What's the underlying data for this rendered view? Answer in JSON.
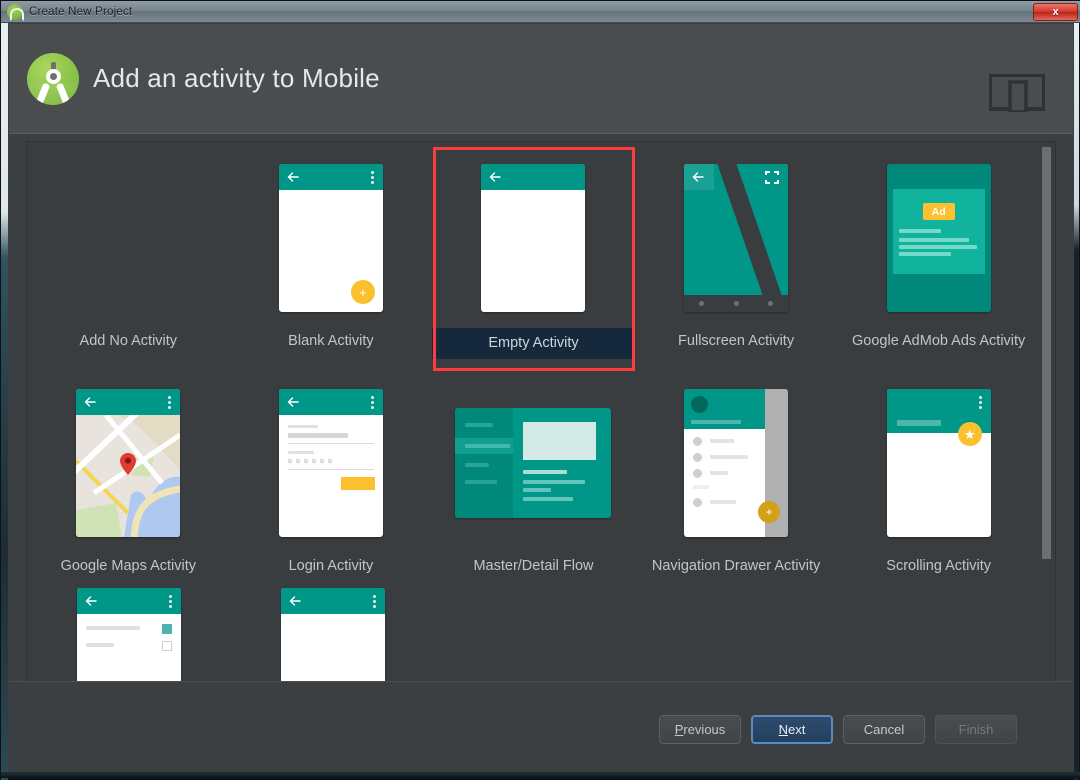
{
  "window": {
    "title": "Create New Project",
    "title_icon": "android-studio-icon",
    "close_label": "x"
  },
  "header": {
    "title": "Add an activity to Mobile",
    "logo": "android-studio-logo",
    "device_icon": "devices-icon"
  },
  "colors": {
    "accent_teal": "#009688",
    "accent_teal_dark": "#00897b",
    "accent_yellow": "#fbc02d",
    "selection_red": "#fd3d3d",
    "selection_label_bg": "#16283c",
    "window_bg": "#3c3f41",
    "gallery_bg": "#3a3d3f",
    "header_bg": "#4a4c4e",
    "default_button_blue": "#2d4b6e"
  },
  "gallery": {
    "selected": "Empty Activity",
    "scrollbar": {
      "visible": true,
      "thumb_position": "top"
    },
    "rows": [
      [
        {
          "label": "Add No Activity",
          "thumb": "none"
        },
        {
          "label": "Blank Activity",
          "thumb": "blank-activity"
        },
        {
          "label": "Empty Activity",
          "thumb": "empty-activity",
          "selected": true
        },
        {
          "label": "Fullscreen Activity",
          "thumb": "fullscreen-activity"
        },
        {
          "label": "Google AdMob Ads Activity",
          "thumb": "admob-activity",
          "badge": "Ad"
        }
      ],
      [
        {
          "label": "Google Maps Activity",
          "thumb": "maps-activity"
        },
        {
          "label": "Login Activity",
          "thumb": "login-activity"
        },
        {
          "label": "Master/Detail Flow",
          "thumb": "master-detail-flow"
        },
        {
          "label": "Navigation Drawer Activity",
          "thumb": "navigation-drawer-activity"
        },
        {
          "label": "Scrolling Activity",
          "thumb": "scrolling-activity"
        }
      ],
      [
        {
          "label": "",
          "thumb": "settings-activity-partial"
        },
        {
          "label": "",
          "thumb": "tabbed-activity-partial"
        }
      ]
    ]
  },
  "footer": {
    "buttons": [
      {
        "label": "Previous",
        "mnemonic": "P",
        "state": "enabled"
      },
      {
        "label": "Next",
        "mnemonic": "N",
        "state": "default"
      },
      {
        "label": "Cancel",
        "mnemonic": "",
        "state": "enabled"
      },
      {
        "label": "Finish",
        "mnemonic": "",
        "state": "disabled"
      }
    ]
  }
}
